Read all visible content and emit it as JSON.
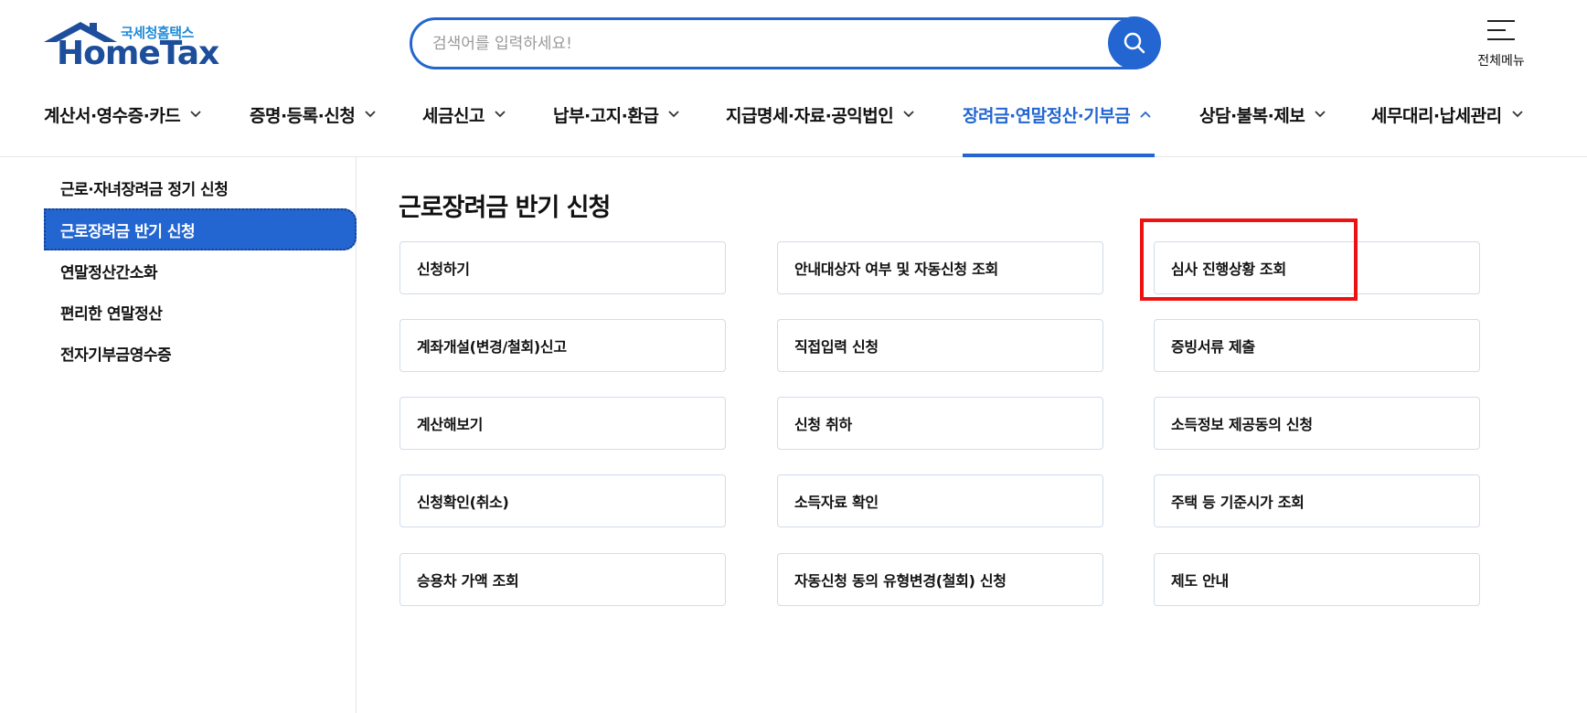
{
  "logo": {
    "subtitle": "국세청홈택스",
    "title": "HomeTax"
  },
  "search": {
    "placeholder": "검색어를 입력하세요!"
  },
  "all_menu_label": "전체메뉴",
  "gnb": [
    {
      "label": "계산서·영수증·카드"
    },
    {
      "label": "증명·등록·신청"
    },
    {
      "label": "세금신고"
    },
    {
      "label": "납부·고지·환급"
    },
    {
      "label": "지급명세·자료·공익법인"
    },
    {
      "label": "장려금·연말정산·기부금"
    },
    {
      "label": "상담·불복·제보"
    },
    {
      "label": "세무대리·납세관리"
    }
  ],
  "sidebar": {
    "items": [
      {
        "label": "근로·자녀장려금 정기 신청"
      },
      {
        "label": "근로장려금 반기 신청"
      },
      {
        "label": "연말정산간소화"
      },
      {
        "label": "편리한 연말정산"
      },
      {
        "label": "전자기부금영수증"
      }
    ]
  },
  "main": {
    "title": "근로장려금 반기 신청",
    "cards": [
      {
        "label": "신청하기"
      },
      {
        "label": "안내대상자 여부 및 자동신청 조회"
      },
      {
        "label": "심사 진행상황 조회"
      },
      {
        "label": "계좌개설(변경/철회)신고"
      },
      {
        "label": "직접입력 신청"
      },
      {
        "label": "증빙서류 제출"
      },
      {
        "label": "계산해보기"
      },
      {
        "label": "신청 취하"
      },
      {
        "label": "소득정보 제공동의 신청"
      },
      {
        "label": "신청확인(취소)"
      },
      {
        "label": "소득자료 확인"
      },
      {
        "label": "주택 등 기준시가 조회"
      },
      {
        "label": "승용차 가액 조회"
      },
      {
        "label": "자동신청 동의 유형변경(철회) 신청"
      },
      {
        "label": "제도 안내"
      }
    ]
  },
  "colors": {
    "accent": "#2366d1",
    "logo_blue": "#1d4e9c",
    "highlight": "#ee1111"
  }
}
